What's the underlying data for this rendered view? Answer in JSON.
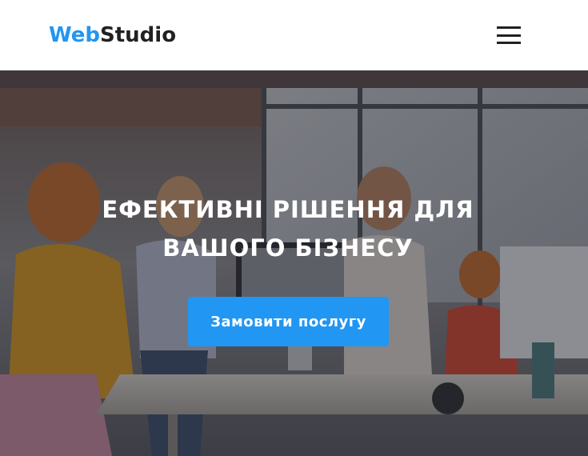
{
  "header": {
    "logo_part1": "Web",
    "logo_part2": "Studio",
    "menu_icon": "hamburger-menu-icon"
  },
  "hero": {
    "title": "Ефективні рішення для вашого бізнесу",
    "cta_label": "Замовити послугу",
    "background": "office-team-photo"
  },
  "colors": {
    "accent": "#2196f3",
    "text_dark": "#212121",
    "white": "#ffffff"
  }
}
